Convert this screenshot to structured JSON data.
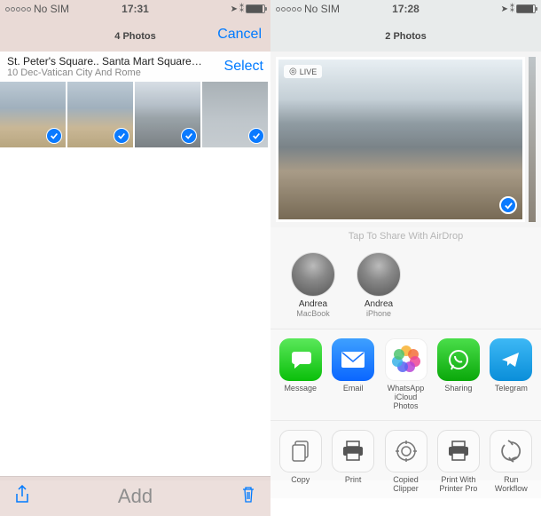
{
  "left": {
    "status": {
      "carrier": "No SIM",
      "time": "17:31"
    },
    "nav": {
      "title": "4 Photos",
      "cancel": "Cancel"
    },
    "album": {
      "names": "St. Peter's Square.. Santa Mart Square....",
      "date": "10 Dec-Vatican City And Rome",
      "select": "Select"
    },
    "bottom": {
      "add": "Add"
    }
  },
  "right": {
    "status": {
      "carrier": "No SIM",
      "time": "17:28"
    },
    "nav": {
      "title": "2 Photos"
    },
    "live_badge": "LIVE",
    "share_hint": "Tap To Share With AirDrop",
    "contacts": [
      {
        "name": "Andrea",
        "device": "MacBook"
      },
      {
        "name": "Andrea",
        "device": "iPhone"
      }
    ],
    "apps": [
      {
        "label": "Message",
        "icon": "message"
      },
      {
        "label": "Email",
        "icon": "mail"
      },
      {
        "label": "WhatsApp\niCloud Photos",
        "icon": "photos"
      },
      {
        "label": "Sharing",
        "icon": "whatsapp"
      },
      {
        "label": "Telegram",
        "icon": "telegram"
      }
    ],
    "actions": [
      {
        "label": "Copy",
        "icon": "copy"
      },
      {
        "label": "Print",
        "icon": "print"
      },
      {
        "label": "Copied\nClipper",
        "icon": "clip"
      },
      {
        "label": "Print With\nPrinter Pro",
        "icon": "printerpro"
      },
      {
        "label": "Run\nWorkflow",
        "icon": "workflow"
      }
    ]
  }
}
